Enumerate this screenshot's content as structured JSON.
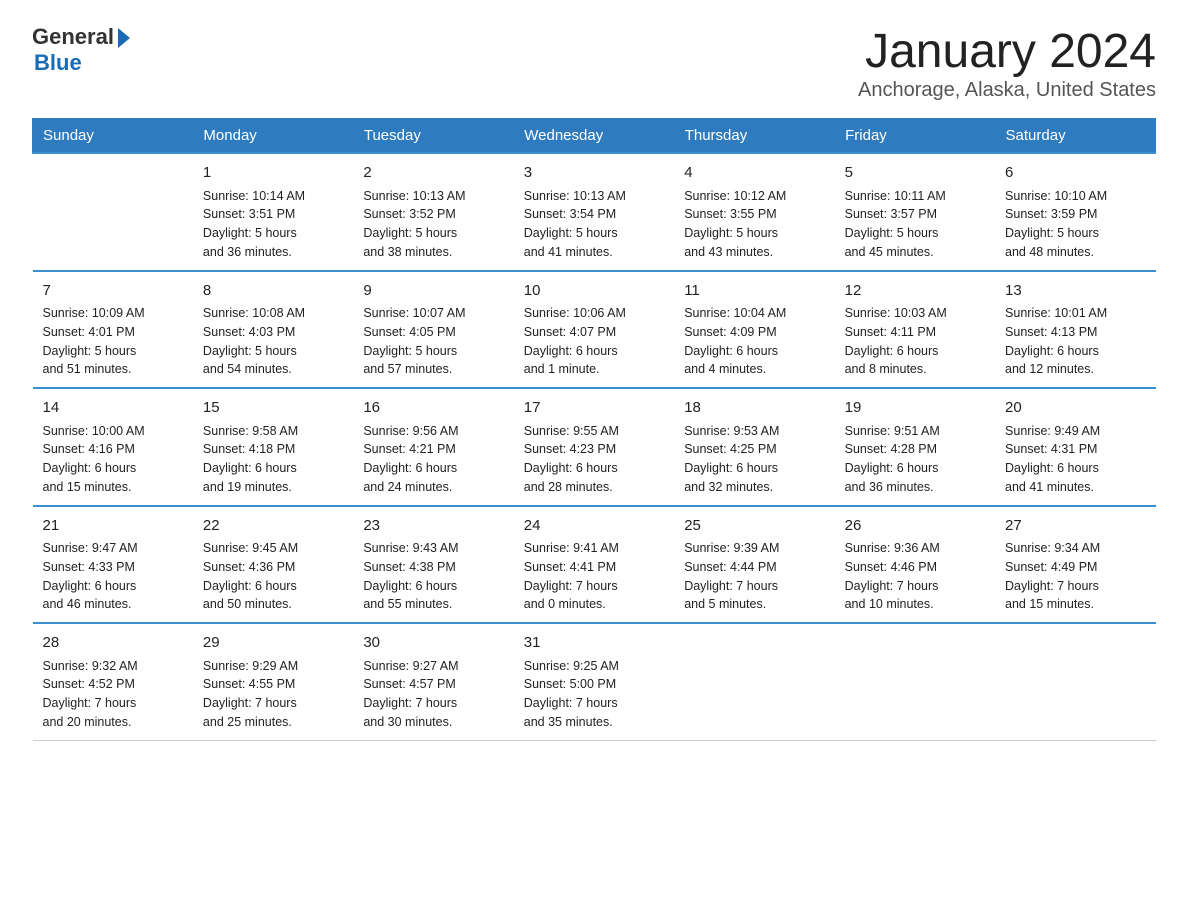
{
  "logo": {
    "general": "General",
    "blue": "Blue"
  },
  "title": "January 2024",
  "subtitle": "Anchorage, Alaska, United States",
  "days": [
    "Sunday",
    "Monday",
    "Tuesday",
    "Wednesday",
    "Thursday",
    "Friday",
    "Saturday"
  ],
  "weeks": [
    [
      {
        "num": "",
        "info": ""
      },
      {
        "num": "1",
        "info": "Sunrise: 10:14 AM\nSunset: 3:51 PM\nDaylight: 5 hours\nand 36 minutes."
      },
      {
        "num": "2",
        "info": "Sunrise: 10:13 AM\nSunset: 3:52 PM\nDaylight: 5 hours\nand 38 minutes."
      },
      {
        "num": "3",
        "info": "Sunrise: 10:13 AM\nSunset: 3:54 PM\nDaylight: 5 hours\nand 41 minutes."
      },
      {
        "num": "4",
        "info": "Sunrise: 10:12 AM\nSunset: 3:55 PM\nDaylight: 5 hours\nand 43 minutes."
      },
      {
        "num": "5",
        "info": "Sunrise: 10:11 AM\nSunset: 3:57 PM\nDaylight: 5 hours\nand 45 minutes."
      },
      {
        "num": "6",
        "info": "Sunrise: 10:10 AM\nSunset: 3:59 PM\nDaylight: 5 hours\nand 48 minutes."
      }
    ],
    [
      {
        "num": "7",
        "info": "Sunrise: 10:09 AM\nSunset: 4:01 PM\nDaylight: 5 hours\nand 51 minutes."
      },
      {
        "num": "8",
        "info": "Sunrise: 10:08 AM\nSunset: 4:03 PM\nDaylight: 5 hours\nand 54 minutes."
      },
      {
        "num": "9",
        "info": "Sunrise: 10:07 AM\nSunset: 4:05 PM\nDaylight: 5 hours\nand 57 minutes."
      },
      {
        "num": "10",
        "info": "Sunrise: 10:06 AM\nSunset: 4:07 PM\nDaylight: 6 hours\nand 1 minute."
      },
      {
        "num": "11",
        "info": "Sunrise: 10:04 AM\nSunset: 4:09 PM\nDaylight: 6 hours\nand 4 minutes."
      },
      {
        "num": "12",
        "info": "Sunrise: 10:03 AM\nSunset: 4:11 PM\nDaylight: 6 hours\nand 8 minutes."
      },
      {
        "num": "13",
        "info": "Sunrise: 10:01 AM\nSunset: 4:13 PM\nDaylight: 6 hours\nand 12 minutes."
      }
    ],
    [
      {
        "num": "14",
        "info": "Sunrise: 10:00 AM\nSunset: 4:16 PM\nDaylight: 6 hours\nand 15 minutes."
      },
      {
        "num": "15",
        "info": "Sunrise: 9:58 AM\nSunset: 4:18 PM\nDaylight: 6 hours\nand 19 minutes."
      },
      {
        "num": "16",
        "info": "Sunrise: 9:56 AM\nSunset: 4:21 PM\nDaylight: 6 hours\nand 24 minutes."
      },
      {
        "num": "17",
        "info": "Sunrise: 9:55 AM\nSunset: 4:23 PM\nDaylight: 6 hours\nand 28 minutes."
      },
      {
        "num": "18",
        "info": "Sunrise: 9:53 AM\nSunset: 4:25 PM\nDaylight: 6 hours\nand 32 minutes."
      },
      {
        "num": "19",
        "info": "Sunrise: 9:51 AM\nSunset: 4:28 PM\nDaylight: 6 hours\nand 36 minutes."
      },
      {
        "num": "20",
        "info": "Sunrise: 9:49 AM\nSunset: 4:31 PM\nDaylight: 6 hours\nand 41 minutes."
      }
    ],
    [
      {
        "num": "21",
        "info": "Sunrise: 9:47 AM\nSunset: 4:33 PM\nDaylight: 6 hours\nand 46 minutes."
      },
      {
        "num": "22",
        "info": "Sunrise: 9:45 AM\nSunset: 4:36 PM\nDaylight: 6 hours\nand 50 minutes."
      },
      {
        "num": "23",
        "info": "Sunrise: 9:43 AM\nSunset: 4:38 PM\nDaylight: 6 hours\nand 55 minutes."
      },
      {
        "num": "24",
        "info": "Sunrise: 9:41 AM\nSunset: 4:41 PM\nDaylight: 7 hours\nand 0 minutes."
      },
      {
        "num": "25",
        "info": "Sunrise: 9:39 AM\nSunset: 4:44 PM\nDaylight: 7 hours\nand 5 minutes."
      },
      {
        "num": "26",
        "info": "Sunrise: 9:36 AM\nSunset: 4:46 PM\nDaylight: 7 hours\nand 10 minutes."
      },
      {
        "num": "27",
        "info": "Sunrise: 9:34 AM\nSunset: 4:49 PM\nDaylight: 7 hours\nand 15 minutes."
      }
    ],
    [
      {
        "num": "28",
        "info": "Sunrise: 9:32 AM\nSunset: 4:52 PM\nDaylight: 7 hours\nand 20 minutes."
      },
      {
        "num": "29",
        "info": "Sunrise: 9:29 AM\nSunset: 4:55 PM\nDaylight: 7 hours\nand 25 minutes."
      },
      {
        "num": "30",
        "info": "Sunrise: 9:27 AM\nSunset: 4:57 PM\nDaylight: 7 hours\nand 30 minutes."
      },
      {
        "num": "31",
        "info": "Sunrise: 9:25 AM\nSunset: 5:00 PM\nDaylight: 7 hours\nand 35 minutes."
      },
      {
        "num": "",
        "info": ""
      },
      {
        "num": "",
        "info": ""
      },
      {
        "num": "",
        "info": ""
      }
    ]
  ]
}
